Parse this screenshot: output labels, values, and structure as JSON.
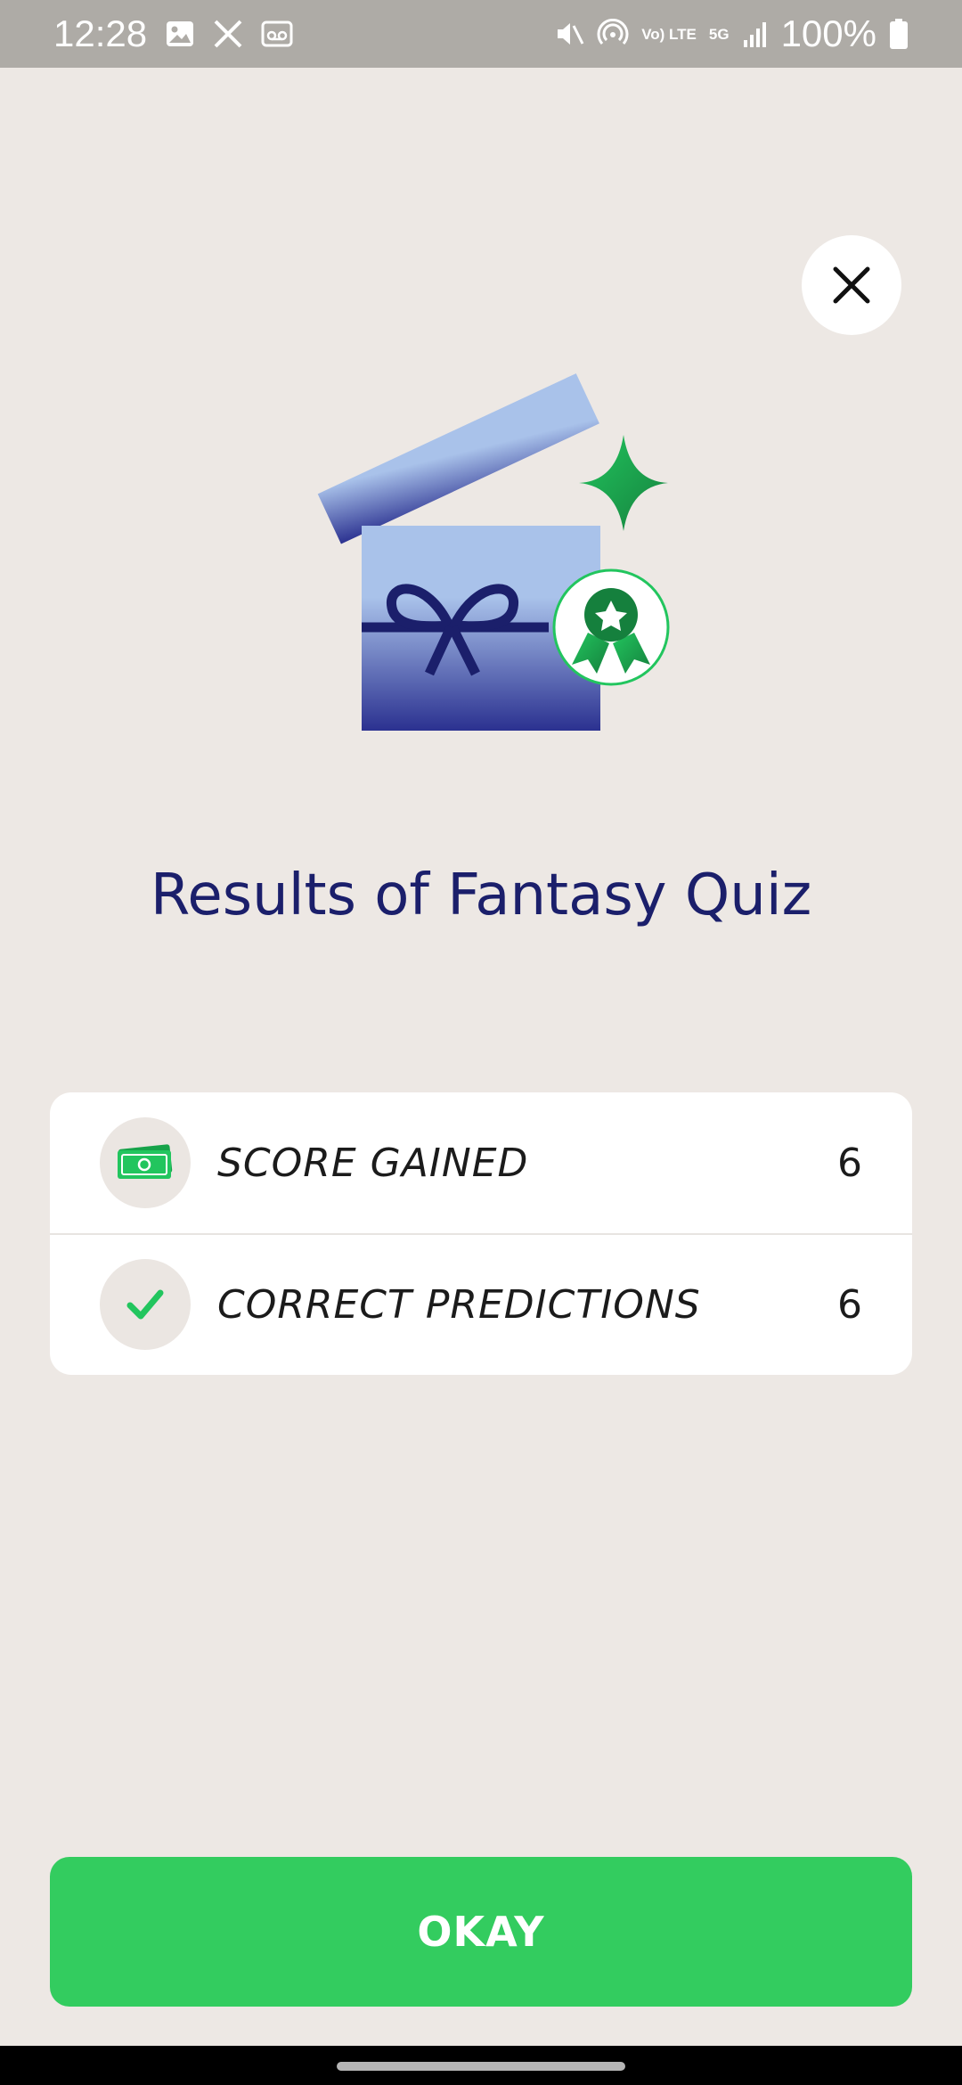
{
  "status_bar": {
    "time": "12:28",
    "left_icons": [
      "image-icon",
      "x-logo-icon",
      "voicemail-icon"
    ],
    "right_icons": [
      "mute-icon",
      "hotspot-icon",
      "volte-icon",
      "5g-icon",
      "signal-icon",
      "battery-icon"
    ],
    "volte_label": "Vo) LTE",
    "network_label": "5G",
    "battery": "100%"
  },
  "dialog": {
    "close_icon": "close-icon",
    "illustration_icon": "gift-box-with-award-icon",
    "title": "Results of Fantasy Quiz",
    "results": [
      {
        "icon": "money-icon",
        "label": "SCORE GAINED",
        "value": "6"
      },
      {
        "icon": "checkmark-icon",
        "label": "CORRECT PREDICTIONS",
        "value": "6"
      }
    ],
    "okay_label": "OKAY"
  },
  "colors": {
    "background": "#ede8e4",
    "title": "#1b1f6b",
    "accent_green": "#33cc5f",
    "box_blue": "#a9c2ea",
    "box_navy": "#2b3190",
    "status_bar": "#aeaba6"
  }
}
